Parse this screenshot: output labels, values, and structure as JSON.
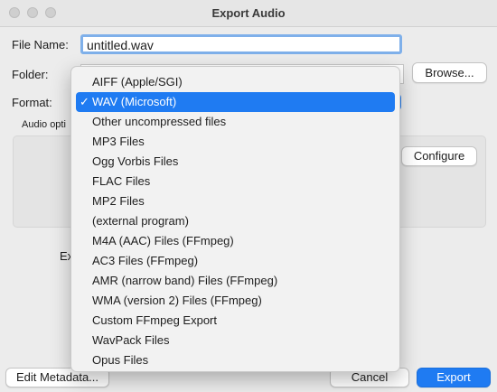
{
  "window": {
    "title": "Export Audio"
  },
  "form": {
    "file_name_label": "File Name:",
    "file_name_value": "untitled.wav",
    "folder_label": "Folder:",
    "browse_label": "Browse...",
    "format_label": "Format:",
    "audio_options_label": "Audio opti",
    "configure_label": "Configure",
    "hidden_row_label": "Ex"
  },
  "footer": {
    "edit_metadata_label": "Edit Metadata...",
    "cancel_label": "Cancel",
    "export_label": "Export"
  },
  "format_menu": {
    "selected_index": 1,
    "check_glyph": "✓",
    "items": [
      {
        "label": "AIFF (Apple/SGI)"
      },
      {
        "label": "WAV (Microsoft)"
      },
      {
        "label": "Other uncompressed files"
      },
      {
        "label": "MP3 Files"
      },
      {
        "label": "Ogg Vorbis Files"
      },
      {
        "label": "FLAC Files"
      },
      {
        "label": "MP2 Files"
      },
      {
        "label": "(external program)"
      },
      {
        "label": "M4A (AAC) Files (FFmpeg)"
      },
      {
        "label": "AC3 Files (FFmpeg)"
      },
      {
        "label": "AMR (narrow band) Files (FFmpeg)"
      },
      {
        "label": "WMA (version 2) Files (FFmpeg)"
      },
      {
        "label": "Custom FFmpeg Export"
      },
      {
        "label": "WavPack Files"
      },
      {
        "label": "Opus Files"
      }
    ]
  }
}
